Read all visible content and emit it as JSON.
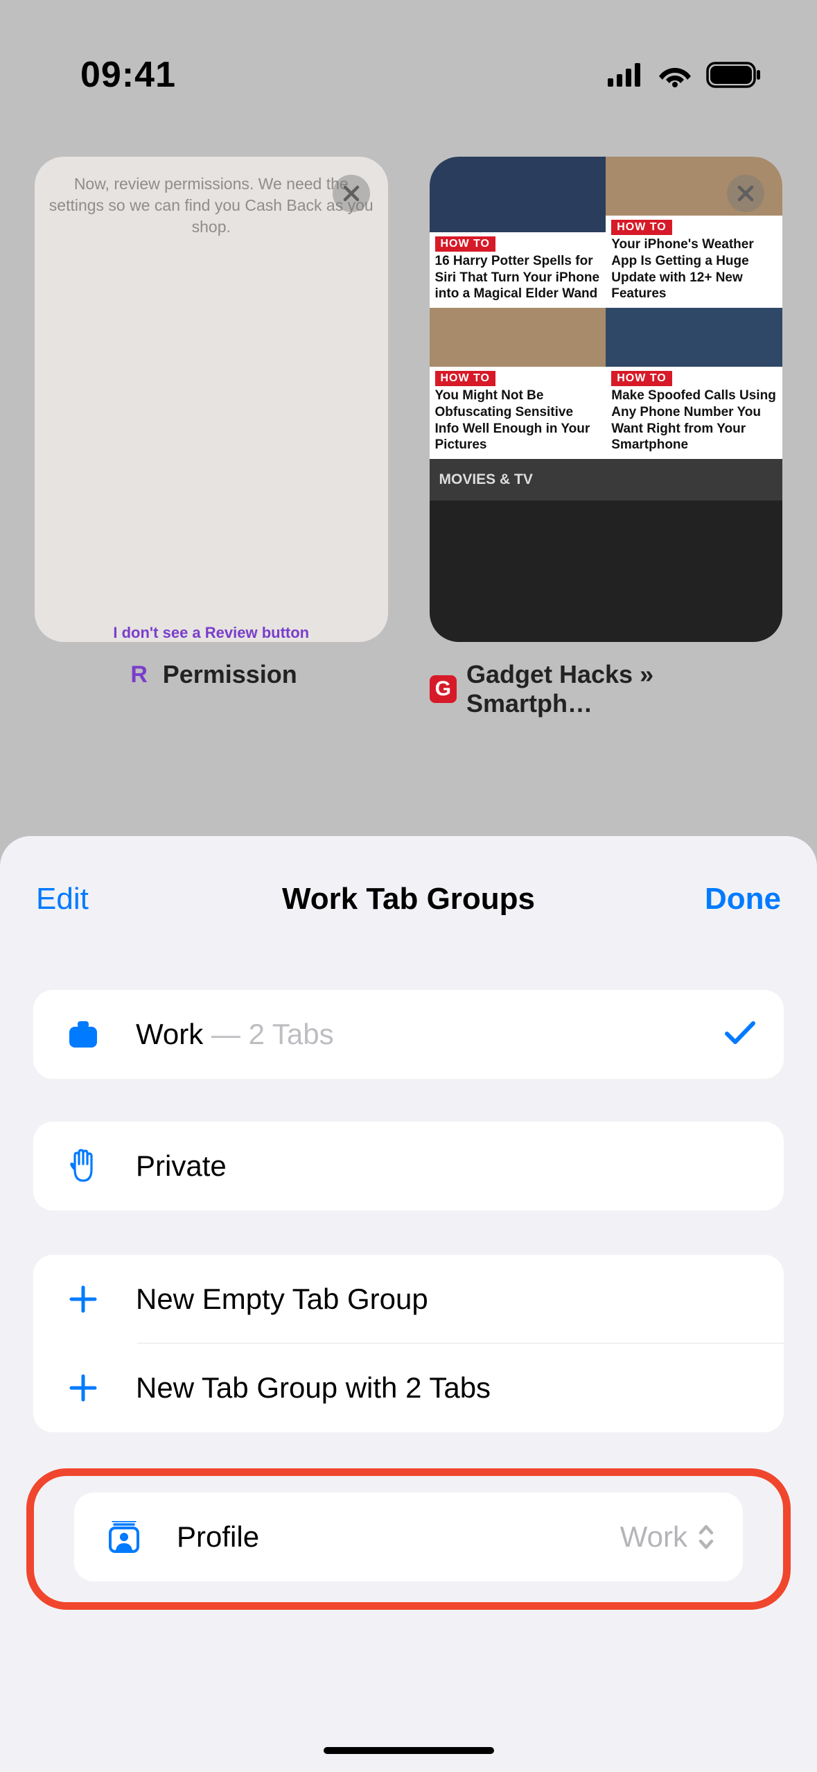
{
  "status": {
    "time": "09:41"
  },
  "tabs": [
    {
      "favicon": "R",
      "title": "Permission",
      "preview_text": "Now, review permissions. We need the settings so we can find you Cash Back as you shop.",
      "preview_bottom": "I don't see a Review button"
    },
    {
      "favicon": "G",
      "title": "Gadget Hacks » Smartph…",
      "cells": [
        {
          "tag": "HOW TO",
          "text": "16 Harry Potter Spells for Siri That Turn Your iPhone into a Magical Elder Wand"
        },
        {
          "tag": "HOW TO",
          "text": "Your iPhone's Weather App Is Getting a Huge Update with 12+ New Features"
        },
        {
          "tag": "HOW TO",
          "text": "You Might Not Be Obfuscating Sensitive Info Well Enough in Your Pictures"
        },
        {
          "tag": "HOW TO",
          "text": "Make Spoofed Calls Using Any Phone Number You Want Right from Your Smartphone"
        }
      ],
      "section": "MOVIES & TV"
    }
  ],
  "sheet": {
    "edit": "Edit",
    "title": "Work Tab Groups",
    "done": "Done",
    "work_label": "Work",
    "work_sep": " — ",
    "work_count": "2 Tabs",
    "private_label": "Private",
    "new_empty": "New Empty Tab Group",
    "new_with": "New Tab Group with 2 Tabs",
    "profile_label": "Profile",
    "profile_value": "Work"
  }
}
